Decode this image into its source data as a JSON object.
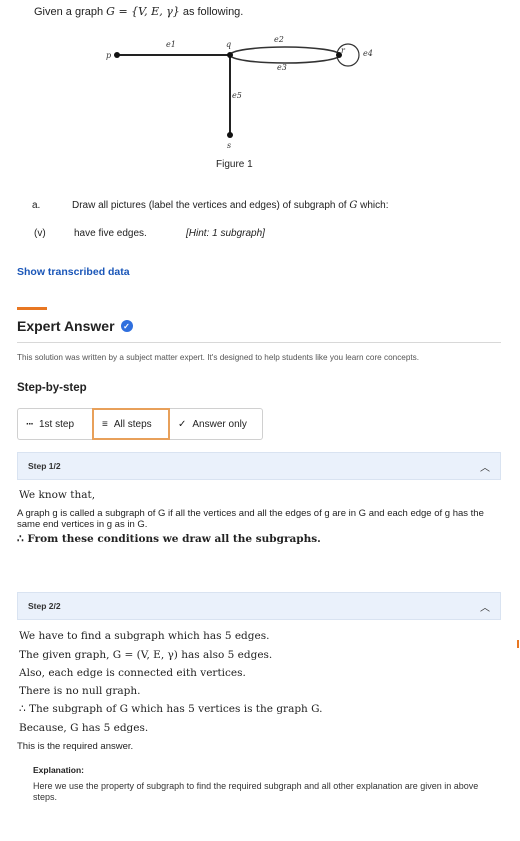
{
  "question": {
    "intro": "Given a graph ",
    "graph_symbol": "G = {V, E, γ}",
    "intro_tail": " as following.",
    "figure": {
      "caption": "Figure 1",
      "vertices": [
        "p",
        "q",
        "r",
        "s"
      ],
      "edges": [
        "e1",
        "e2",
        "e3",
        "e4",
        "e5"
      ]
    },
    "part_a_label": "a.",
    "part_a_text_start": "Draw all pictures (label the vertices and edges) of subgraph of ",
    "part_a_symbol": "G",
    "part_a_text_end": " which:",
    "part_v_label": "(v)",
    "part_v_text": "have five edges.",
    "hint": "[Hint: 1 subgraph]"
  },
  "show_transcribed": "Show transcribed data",
  "expert": {
    "title": "Expert Answer",
    "verified_icon": "verified-badge-icon",
    "note": "This solution was written by a subject matter expert. It's designed to help students like you learn core concepts.",
    "steps_heading": "Step-by-step",
    "tabs": [
      {
        "icon": "dots-icon",
        "label": "1st step"
      },
      {
        "icon": "list-icon",
        "label": "All steps"
      },
      {
        "icon": "check-icon",
        "label": "Answer only"
      }
    ],
    "active_tab": "All steps"
  },
  "steps": [
    {
      "label": "Step 1/2",
      "lines": [
        "We know that,",
        "A graph g is called a subgraph of G if all the vertices and all the edges of g are in G and each edge of g has the same end vertices in g as in G.",
        "∴ From these conditions we draw all the subgraphs."
      ]
    },
    {
      "label": "Step 2/2",
      "lines": [
        "We have to find a subgraph which has 5 edges.",
        "The given graph, G = (V, E, γ) has also 5 edges.",
        "Also, each edge is connected eith vertices.",
        "There is no null graph.",
        "∴ The subgraph of G which has 5 vertices is the graph G.",
        "Because, G has 5 edges.",
        "This is the required answer."
      ],
      "explanation_head": "Explanation:",
      "explanation": "Here we use the property of subgraph to find the required subgraph and all other explanation are given in above steps."
    }
  ]
}
